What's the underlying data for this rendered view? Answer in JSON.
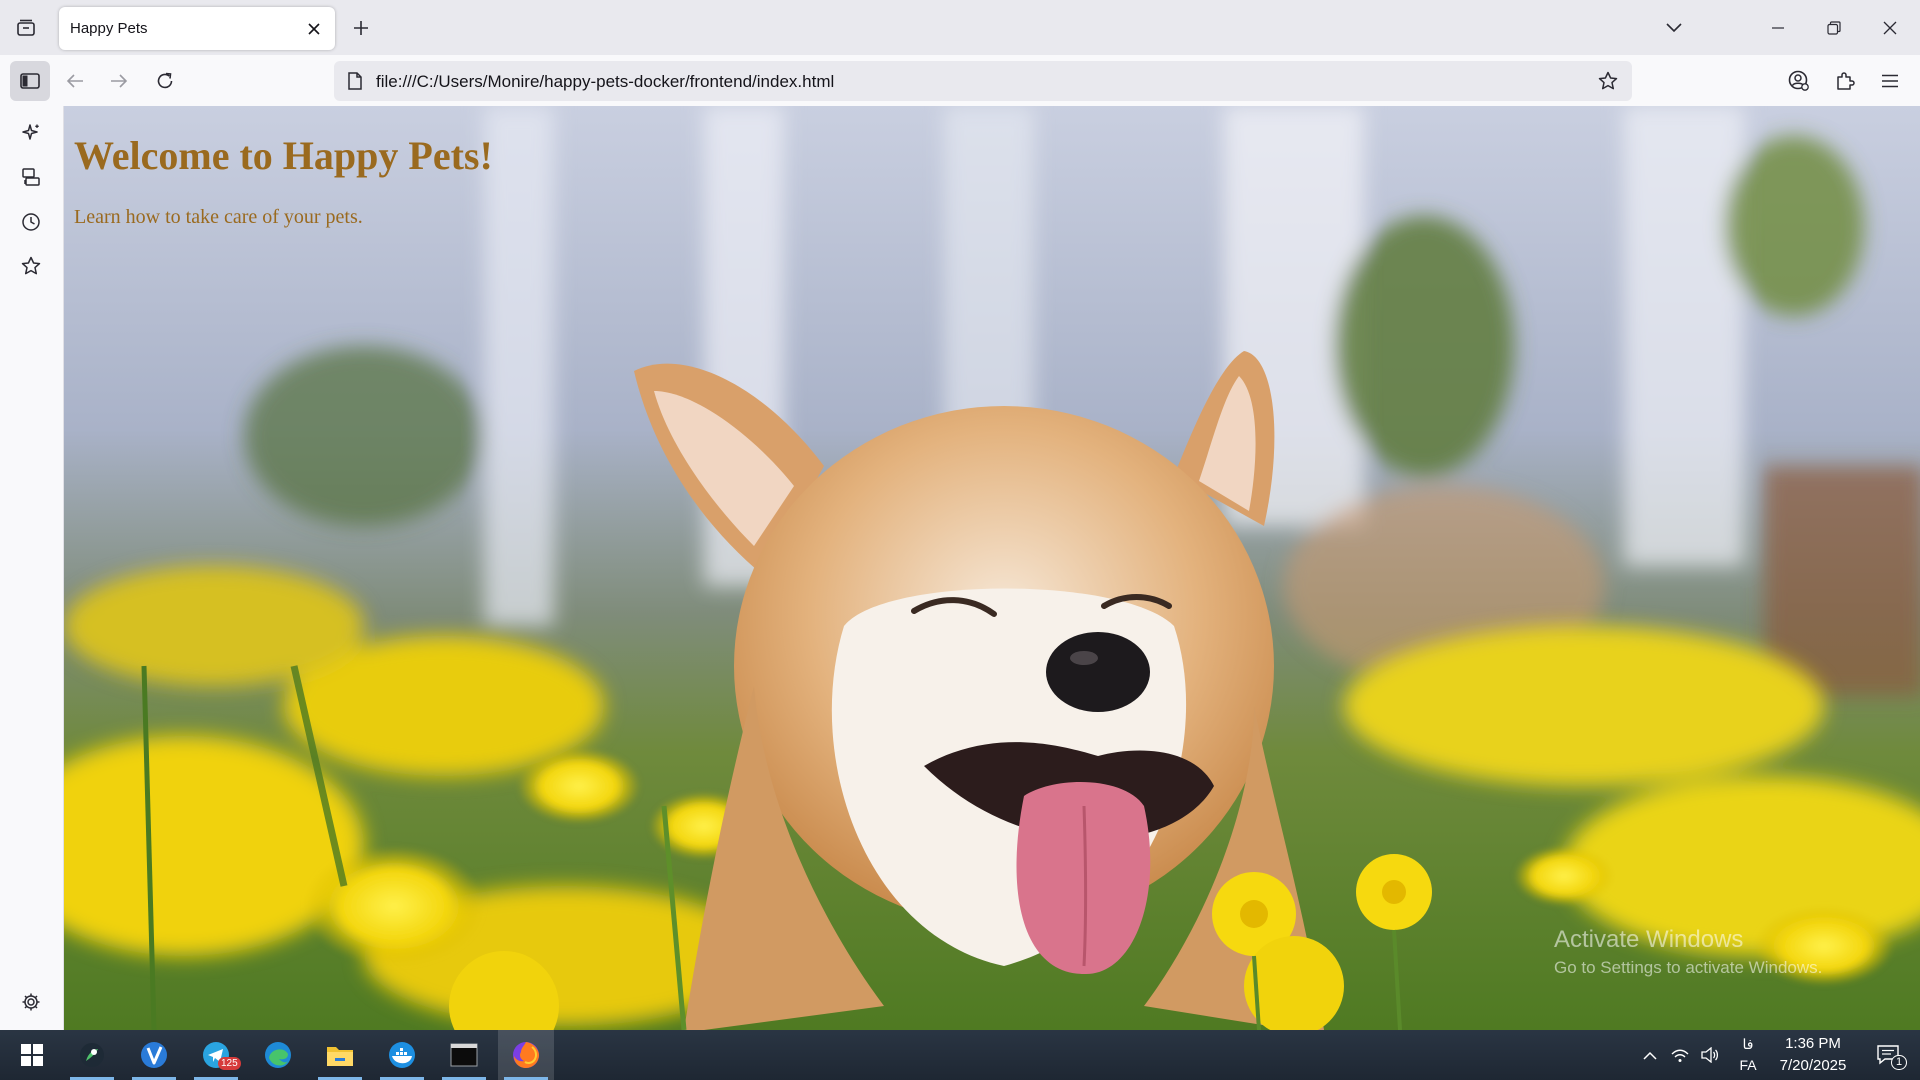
{
  "browser": {
    "tab": {
      "title": "Happy Pets"
    },
    "url": "file:///C:/Users/Monire/happy-pets-docker/frontend/index.html",
    "icons": [
      "tab-list-icon",
      "close-icon",
      "plus-icon",
      "chevron-down-icon",
      "minimize-icon",
      "restore-icon",
      "window-close-icon",
      "sidebar-toggle-icon",
      "back-icon",
      "forward-icon",
      "reload-icon",
      "page-icon",
      "bookmark-star-icon",
      "account-icon",
      "extensions-icon",
      "menu-icon"
    ]
  },
  "sidebar": {
    "icons": [
      "ai-sparkle-icon",
      "synced-tabs-icon",
      "history-icon",
      "bookmarks-icon",
      "settings-icon"
    ]
  },
  "page": {
    "heading": "Welcome to Happy Pets!",
    "subtitle": "Learn how to take care of your pets.",
    "watermark_line1": "Activate Windows",
    "watermark_line2": "Go to Settings to activate Windows.",
    "heading_color": "#9a6a1f"
  },
  "taskbar": {
    "apps": [
      "start-icon",
      "maps-app-icon",
      "vpn-app-icon",
      "telegram-icon",
      "edge-icon",
      "file-explorer-icon",
      "docker-icon",
      "terminal-icon",
      "firefox-icon"
    ],
    "telegram_badge": "125",
    "language_top": "فا",
    "language": "FA",
    "time": "1:36 PM",
    "date": "7/20/2025",
    "notification_count": "1"
  }
}
